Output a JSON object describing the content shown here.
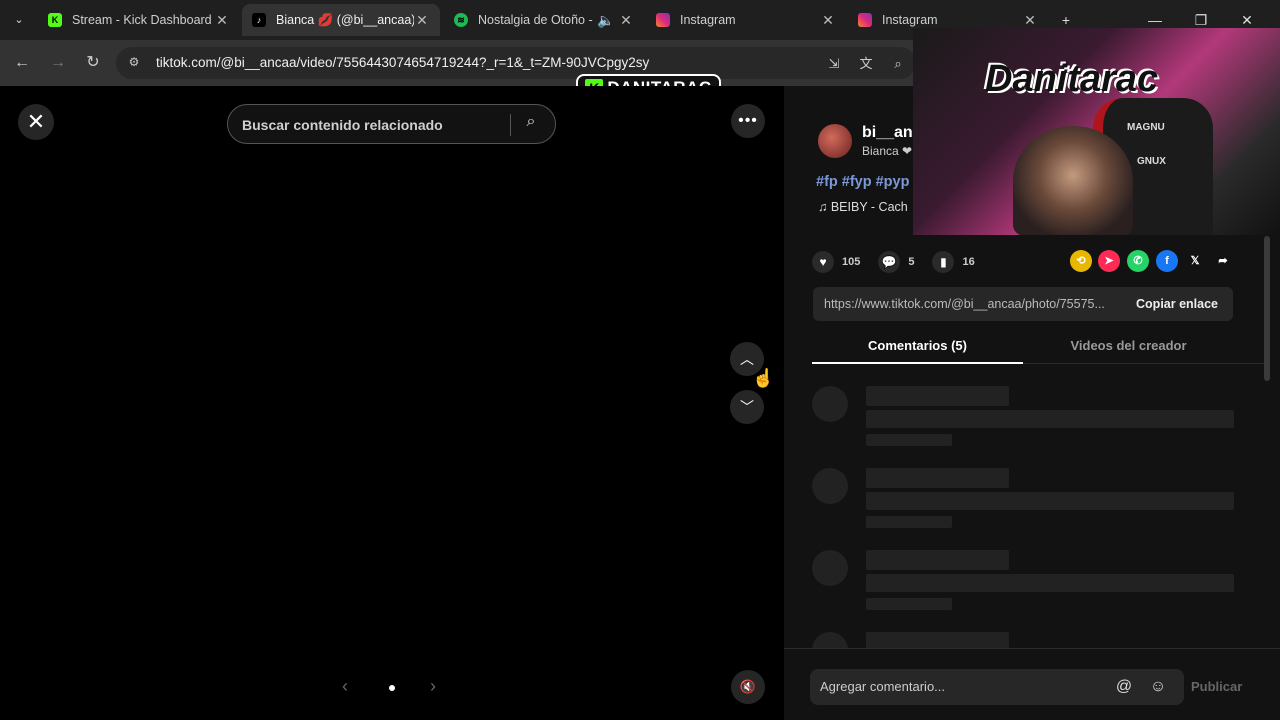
{
  "browser": {
    "tabs": [
      {
        "title": "Stream - Kick Dashboard",
        "icon": "kick-icon"
      },
      {
        "title": "Bianca 💋 (@bi__ancaa)",
        "icon": "tiktok-icon",
        "active": true
      },
      {
        "title": "Nostalgia de Otoño - ",
        "icon": "spotify-icon",
        "audio": true
      },
      {
        "title": "Instagram",
        "icon": "instagram-icon"
      },
      {
        "title": "Instagram",
        "icon": "instagram-icon"
      }
    ],
    "url": "tiktok.com/@bi__ancaa/video/7556443074654719244?_r=1&_t=ZM-90JVCpgy2sy",
    "colors": {
      "kick": "#53fc18",
      "spotify": "#1db954",
      "instagram": "#e1306c"
    }
  },
  "overlay": {
    "name": "DANITARAC",
    "letter": "K",
    "webcam_graffiti": "Danitarac",
    "chair_brand": "MAGNU",
    "chair_brand2": "GNUX"
  },
  "player": {
    "search_placeholder": "Buscar contenido relacionado",
    "close_glyph": "✕"
  },
  "post": {
    "username": "bi__anc",
    "nickname": "Bianca ❤",
    "hashtags": "#fp #fyp #pyp",
    "music": "♫  BEIBY - Cach",
    "likes": "105",
    "comments": "5",
    "saves": "16",
    "link": "https://www.tiktok.com/@bi__ancaa/photo/75575...",
    "copy_label": "Copiar enlace",
    "tab_comments": "Comentarios (5)",
    "tab_creator": "Videos del creador",
    "comment_placeholder": "Agregar comentario...",
    "publish_label": "Publicar"
  }
}
